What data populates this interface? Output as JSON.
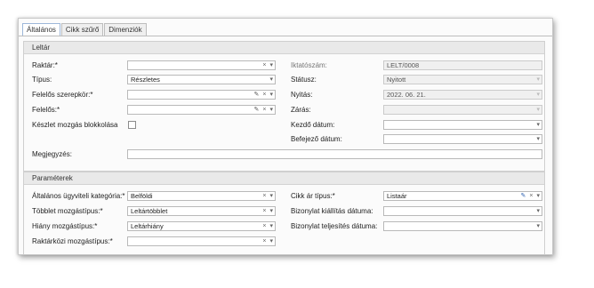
{
  "tabs": [
    {
      "label": "Általános",
      "active": true
    },
    {
      "label": "Cikk szűrő",
      "active": false
    },
    {
      "label": "Dimenziók",
      "active": false
    }
  ],
  "leltar": {
    "title": "Leltár",
    "raktar": {
      "label": "Raktár:*",
      "value": ""
    },
    "tipus": {
      "label": "Típus:",
      "value": "Részletes"
    },
    "felelos_szerepkor": {
      "label": "Felelős szerepkör:*",
      "value": ""
    },
    "felelos": {
      "label": "Felelős:*",
      "value": ""
    },
    "keszlet": {
      "label": "Készlet mozgás blokkolása",
      "checked": false
    },
    "megjegyzes": {
      "label": "Megjegyzés:",
      "value": ""
    },
    "iktatoszam": {
      "label": "Iktatószám:",
      "value": "LELT/0008"
    },
    "statusz": {
      "label": "Státusz:",
      "value": "Nyitott"
    },
    "nyitas": {
      "label": "Nyitás:",
      "value": "2022. 06. 21."
    },
    "zaras": {
      "label": "Zárás:",
      "value": ""
    },
    "kezdo_datum": {
      "label": "Kezdő dátum:",
      "value": ""
    },
    "befejezo_datum": {
      "label": "Befejező dátum:",
      "value": ""
    }
  },
  "parameterek": {
    "title": "Paraméterek",
    "ugyviteli": {
      "label": "Általános ügyviteli kategória:*",
      "value": "Belföldi"
    },
    "tobblet": {
      "label": "Többlet mozgástípus:*",
      "value": "Leltártöbblet"
    },
    "hiany": {
      "label": "Hiány mozgástípus:*",
      "value": "Leltárhiány"
    },
    "raktarkozi": {
      "label": "Raktárközi mozgástípus:*",
      "value": ""
    },
    "cikk_ar": {
      "label": "Cikk ár típus:*",
      "value": "Listaár"
    },
    "kiallitas": {
      "label": "Bizonylat kiállítás dátuma:",
      "value": ""
    },
    "teljesites": {
      "label": "Bizonylat teljesítés dátuma:",
      "value": ""
    }
  },
  "icons": {
    "clear": "×",
    "dropdown": "▾",
    "edit": "✎"
  }
}
